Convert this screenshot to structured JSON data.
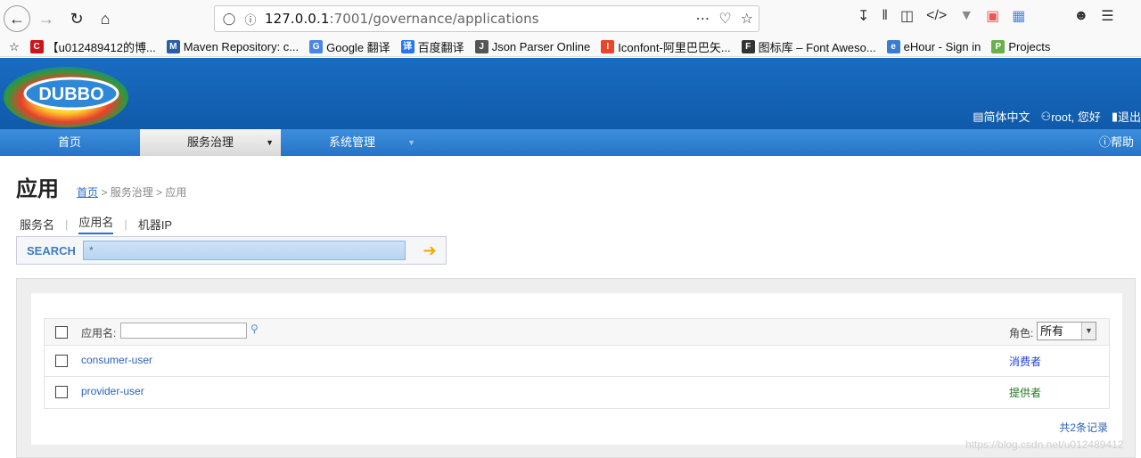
{
  "browser": {
    "url_host": "127.0.0.1",
    "url_rest": ":7001/governance/applications"
  },
  "bookmarks": [
    {
      "label": "【u012489412的博...",
      "color": "#d0121b",
      "glyph": "C"
    },
    {
      "label": "Maven Repository: c...",
      "color": "#2b5ea8",
      "glyph": "M"
    },
    {
      "label": "Google 翻译",
      "color": "#4a86e8",
      "glyph": "G"
    },
    {
      "label": "百度翻译",
      "color": "#2877ee",
      "glyph": "译"
    },
    {
      "label": "Json Parser Online",
      "color": "#555555",
      "glyph": "J"
    },
    {
      "label": "Iconfont-阿里巴巴矢...",
      "color": "#e8452c",
      "glyph": "I"
    },
    {
      "label": "图标库 – Font Aweso...",
      "color": "#333333",
      "glyph": "F"
    },
    {
      "label": "eHour - Sign in",
      "color": "#3a7bd5",
      "glyph": "e"
    },
    {
      "label": "Projects",
      "color": "#6ab04c",
      "glyph": "P"
    }
  ],
  "header": {
    "logo_text": "DUBBO",
    "lang": "简体中文",
    "user": "root, 您好",
    "logout": "退出"
  },
  "menu": {
    "home": "首页",
    "governance": "服务治理",
    "system": "系统管理",
    "help": "帮助"
  },
  "page": {
    "title": "应用",
    "breadcrumb_home": "首页",
    "breadcrumb_rest": " > 服务治理 > 应用"
  },
  "subtabs": [
    "服务名",
    "应用名",
    "机器IP"
  ],
  "search": {
    "label": "SEARCH",
    "value": "*"
  },
  "table": {
    "name_label": "应用名:",
    "role_label": "角色:",
    "role_selected": "所有",
    "rows": [
      {
        "name": "consumer-user",
        "role": "消费者"
      },
      {
        "name": "provider-user",
        "role": "提供者"
      }
    ],
    "total": "共2条记录"
  },
  "watermark": "https://blog.csdn.net/u012489412",
  "colors": {
    "header_blue": "#1a6cc2",
    "menu_blue": "#2573c7",
    "link": "#2a63b8",
    "consumer": "#1f3ee0",
    "provider": "#1c7a1c"
  }
}
